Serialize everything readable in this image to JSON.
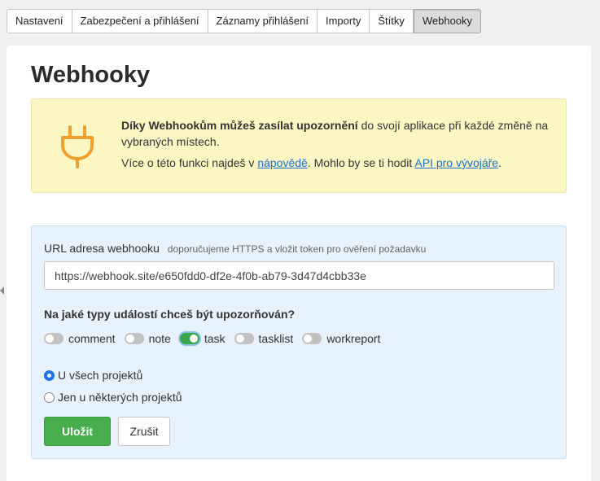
{
  "tabs": [
    {
      "label": "Nastavení"
    },
    {
      "label": "Zabezpečení a přihlášení"
    },
    {
      "label": "Záznamy přihlášení"
    },
    {
      "label": "Importy"
    },
    {
      "label": "Štítky"
    },
    {
      "label": "Webhooky",
      "active": true
    }
  ],
  "page": {
    "title": "Webhooky"
  },
  "notice": {
    "icon": "plug-icon",
    "icon_color": "#f0a030",
    "line1_bold": "Díky Webhookům můžeš zasílat upozornění",
    "line1_rest": " do svojí aplikace při každé změně na vybraných místech.",
    "line2_before": "Více o této funkci najdeš v ",
    "help_link": "nápovědě",
    "line2_middle": ". Mohlo by se ti hodit ",
    "api_link": "API pro vývojáře",
    "line2_after": "."
  },
  "form": {
    "url_label": "URL adresa webhooku",
    "url_hint": "doporučujeme HTTPS a vložit token pro ověření požadavku",
    "url_value": "https://webhook.site/e650fdd0-df2e-4f0b-ab79-3d47d4cbb33e",
    "events_question": "Na jaké typy událostí chceš být upozorňován?",
    "events": [
      {
        "label": "comment",
        "on": false
      },
      {
        "label": "note",
        "on": false
      },
      {
        "label": "task",
        "on": true
      },
      {
        "label": "tasklist",
        "on": false
      },
      {
        "label": "workreport",
        "on": false
      }
    ],
    "scope_options": [
      {
        "label": "U všech projektů",
        "checked": true
      },
      {
        "label": "Jen u některých projektů",
        "checked": false
      }
    ],
    "save_label": "Uložit",
    "cancel_label": "Zrušit"
  },
  "colors": {
    "save_button": "#47ad4d",
    "toggle_on": "#3aa74a",
    "notice_bg": "#fcf6c3",
    "form_bg": "#e7f2fc",
    "link": "#1a6fd0"
  }
}
